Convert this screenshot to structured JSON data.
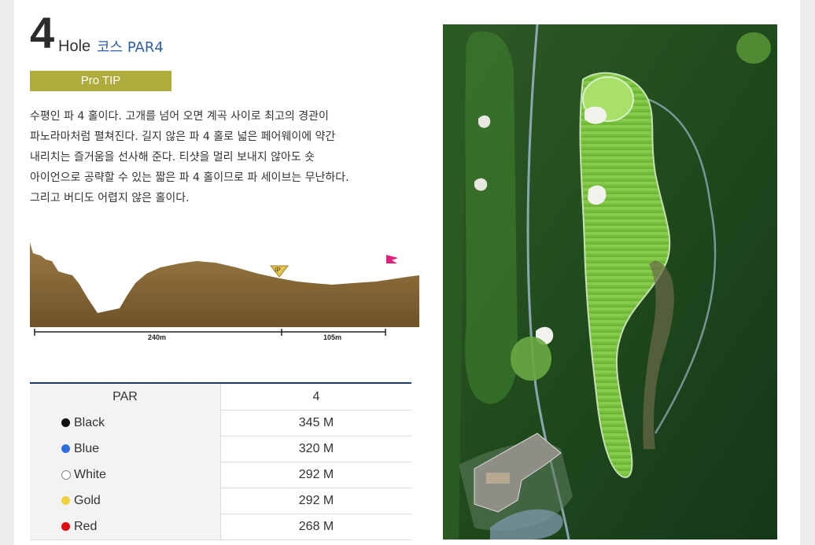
{
  "hole": {
    "number": "4",
    "word": "Hole",
    "course_par": "코스 PAR4"
  },
  "pro_tip": {
    "label": "Pro TIP"
  },
  "description": {
    "lines": [
      "수평인 파 4 홀이다. 고개를 넘어 오면 계곡 사이로 최고의 경관이",
      "파노라마처럼 펼쳐진다. 길지 않은 파 4 홀로 넓은 페어웨이에 약간",
      "내리치는 즐거움을 선사해 준다. 티샷을 멀리 보내지 않아도 숏",
      "아이언으로 공략할 수 있는 짧은 파 4 홀이므로 파 세이브는 무난하다.",
      "그리고 버디도 어렵지 않은 홀이다."
    ]
  },
  "profile": {
    "ip_label": "IP",
    "distances": [
      "240m",
      "105m"
    ]
  },
  "scorecard": {
    "header": {
      "label": "PAR",
      "value": "4"
    },
    "tees": [
      {
        "name": "Black",
        "color": "#111111",
        "distance": "345 M",
        "outline": false
      },
      {
        "name": "Blue",
        "color": "#2f6fe0",
        "distance": "320 M",
        "outline": false
      },
      {
        "name": "White",
        "color": "#ffffff",
        "distance": "292 M",
        "outline": true
      },
      {
        "name": "Gold",
        "color": "#f2d23a",
        "distance": "292 M",
        "outline": false
      },
      {
        "name": "Red",
        "color": "#e00d0d",
        "distance": "268 M",
        "outline": false
      }
    ]
  },
  "colors": {
    "course_link": "#2f5fa8",
    "pro_tip_bg": "#b0ac3c",
    "terrain": "#8a6a3a",
    "flag": "#e0207a"
  },
  "map_image": {
    "icon": "aerial-hole-map"
  }
}
